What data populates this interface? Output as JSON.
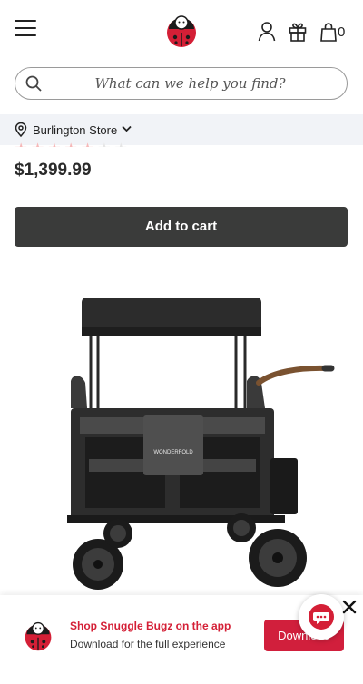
{
  "header": {
    "menu_icon": "hamburger-menu-icon",
    "logo_icon": "ladybug-logo-icon",
    "account_icon": "user-icon",
    "gift_icon": "gift-icon",
    "bag_icon": "shopping-bag-icon",
    "bag_count": "0"
  },
  "search": {
    "icon": "search-icon",
    "placeholder": "What can we help you find?"
  },
  "store": {
    "icon": "location-pin-icon",
    "label": "Burlington Store",
    "chevron_icon": "chevron-down-icon"
  },
  "product": {
    "rating_stars": "★★★★★",
    "price": "$1,399.99",
    "add_to_cart_label": "Add to cart",
    "image_brand_text": "WONDERFOLD"
  },
  "app_banner": {
    "logo_icon": "ladybug-logo-icon",
    "title": "Shop Snuggle Bugz on the app",
    "subtitle": "Download for the full experience",
    "button_label": "Download",
    "close_icon": "close-icon"
  },
  "chat": {
    "icon": "chat-bubble-icon"
  },
  "colors": {
    "accent_red": "#d41f36",
    "button_dark": "#3a3b3a",
    "store_bar_bg": "#f1f3f7"
  }
}
